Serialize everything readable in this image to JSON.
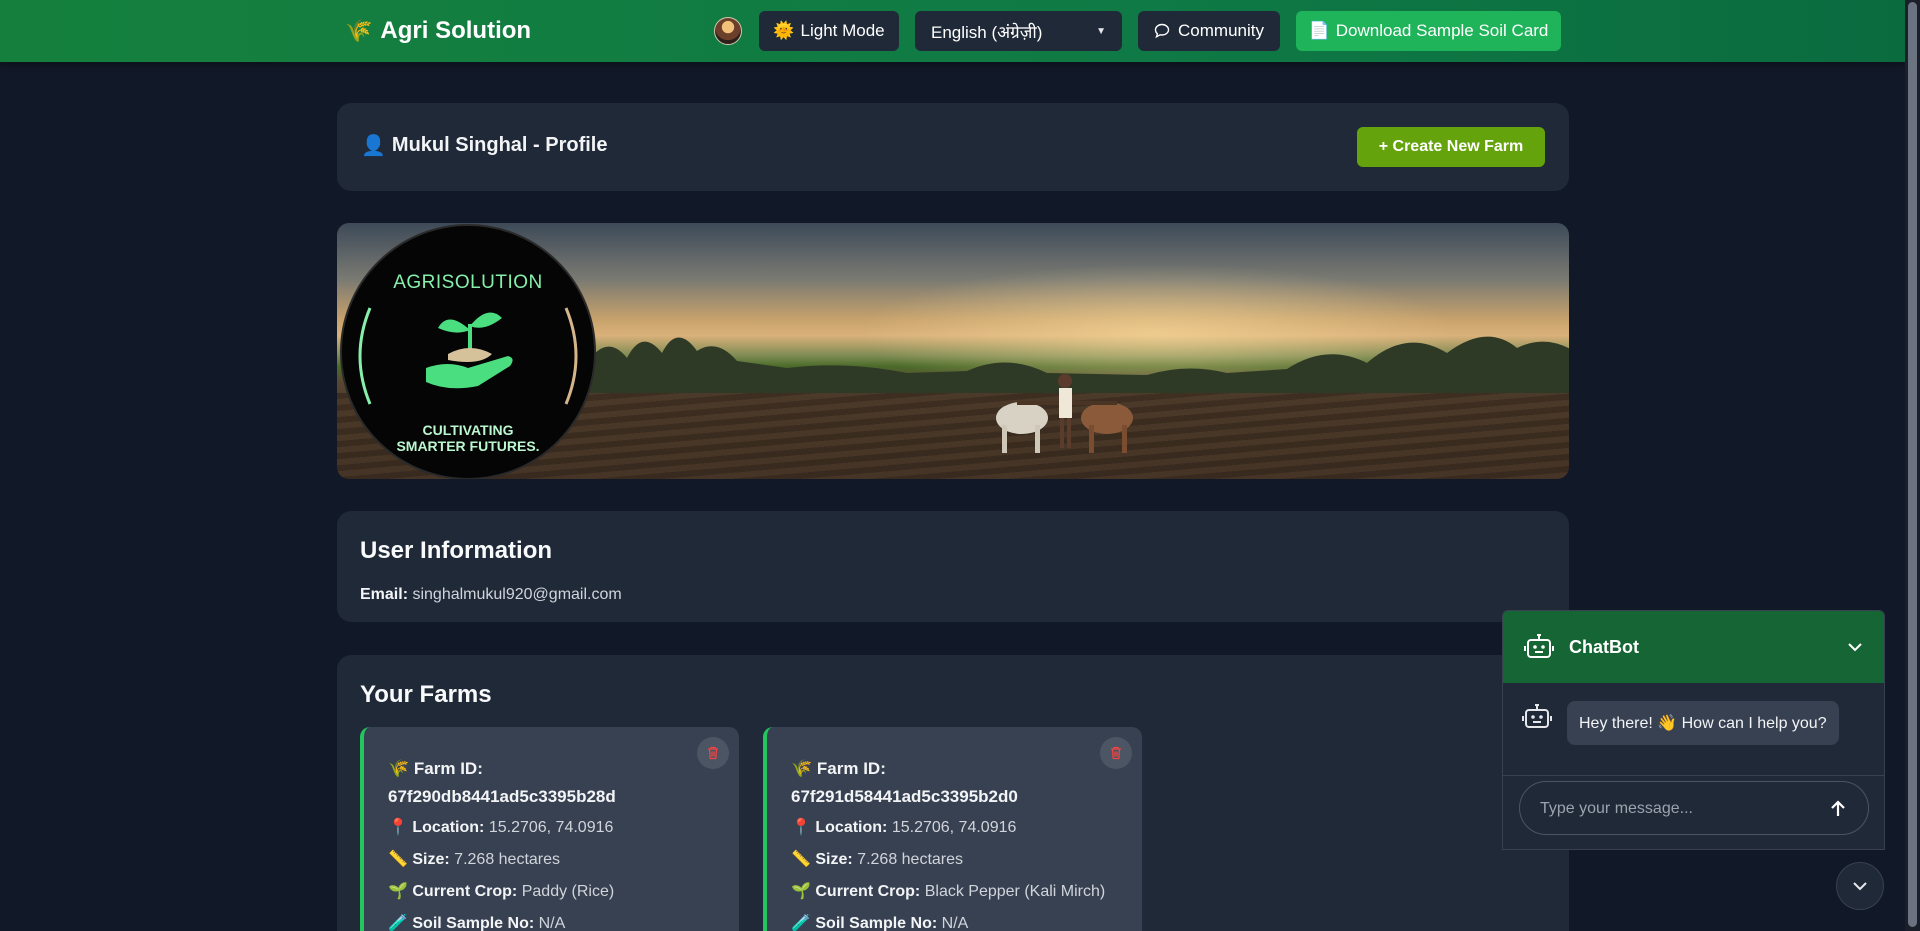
{
  "navbar": {
    "brand_icon": "🌾",
    "brand": "Agri Solution",
    "light_mode_icon": "🌞",
    "light_mode_label": "Light Mode",
    "language_selected": "English (अंग्रेज़ी)",
    "community_label": "Community",
    "download_icon": "📄",
    "download_label": "Download Sample Soil Card"
  },
  "profile": {
    "icon": "👤",
    "title": "Mukul Singhal - Profile",
    "create_button": "+ Create New Farm"
  },
  "banner": {
    "logo_top": "AGRISOLUTION",
    "logo_bottom_1": "CULTIVATING",
    "logo_bottom_2": "SMARTER FUTURES."
  },
  "user_info": {
    "heading": "User Information",
    "email_label": "Email:",
    "email": "singhalmukul920@gmail.com"
  },
  "farms": {
    "heading": "Your Farms",
    "items": [
      {
        "id_icon": "🌾",
        "id_label": "Farm ID:",
        "id": "67f290db8441ad5c3395b28d",
        "location_icon": "📍",
        "location_label": "Location:",
        "location": "15.2706, 74.0916",
        "size_icon": "📏",
        "size_label": "Size:",
        "size": "7.268 hectares",
        "crop_icon": "🌱",
        "crop_label": "Current Crop:",
        "crop": "Paddy (Rice)",
        "soil_icon": "🧪",
        "soil_label": "Soil Sample No:",
        "soil": "N/A"
      },
      {
        "id_icon": "🌾",
        "id_label": "Farm ID:",
        "id": "67f291d58441ad5c3395b2d0",
        "location_icon": "📍",
        "location_label": "Location:",
        "location": "15.2706, 74.0916",
        "size_icon": "📏",
        "size_label": "Size:",
        "size": "7.268 hectares",
        "crop_icon": "🌱",
        "crop_label": "Current Crop:",
        "crop": "Black Pepper (Kali Mirch)",
        "soil_icon": "🧪",
        "soil_label": "Soil Sample No:",
        "soil": "N/A"
      }
    ]
  },
  "chatbot": {
    "title": "ChatBot",
    "greeting": "Hey there! 👋 How can I help you?",
    "input_placeholder": "Type your message..."
  },
  "colors": {
    "navbar": "#15803d",
    "background": "#111827",
    "card": "#1f2937",
    "accent_green": "#22c55e",
    "create_button": "#65a30d",
    "delete_icon": "#ef4444"
  }
}
